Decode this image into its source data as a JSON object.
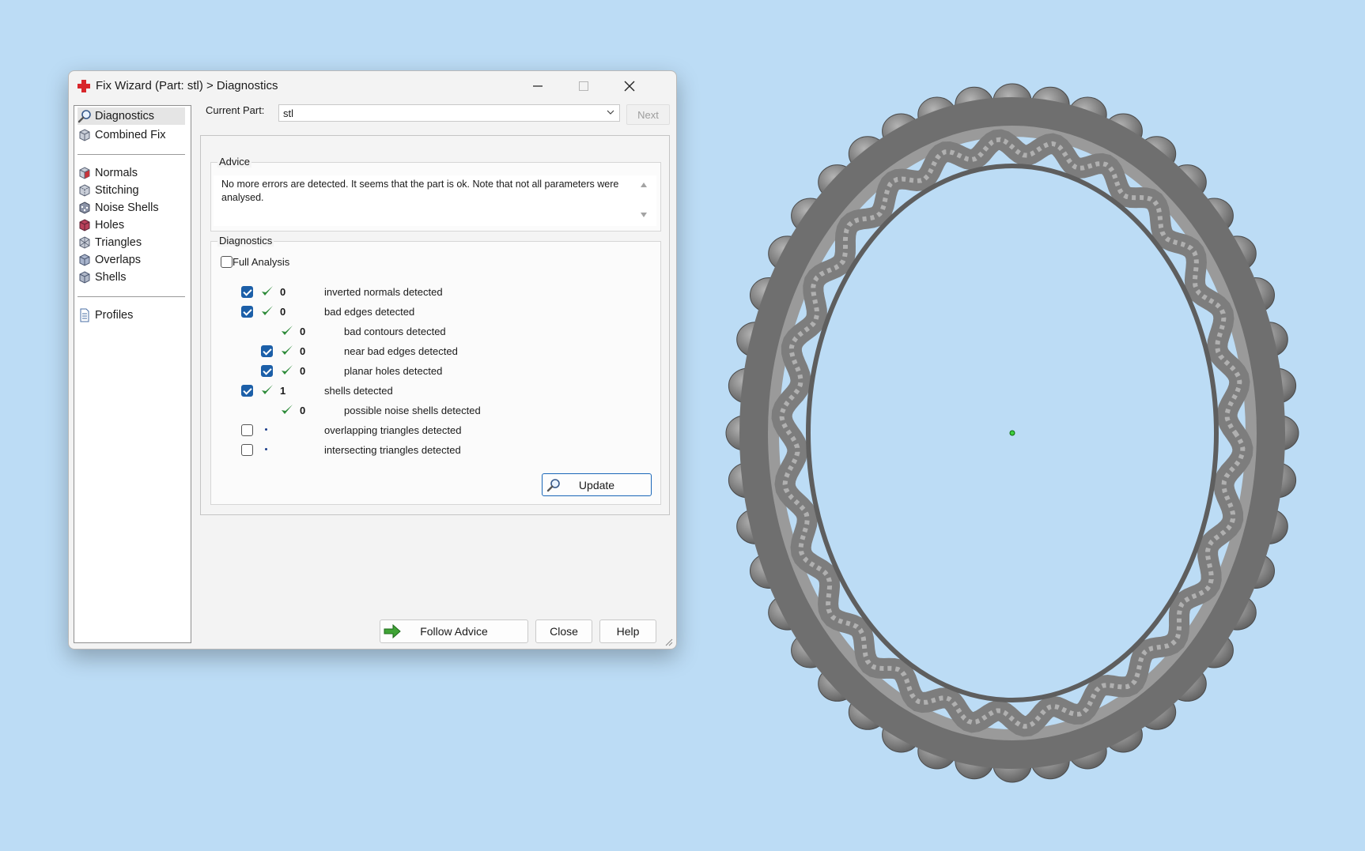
{
  "window": {
    "title": "Fix Wizard (Part: stl) > Diagnostics"
  },
  "nav": {
    "items": [
      {
        "label": "Diagnostics",
        "icon": "magnifier-icon",
        "selected": true
      },
      {
        "label": "Combined Fix",
        "icon": "cube-icon"
      },
      {
        "label": "Normals",
        "icon": "cube-icon"
      },
      {
        "label": "Stitching",
        "icon": "cube-icon"
      },
      {
        "label": "Noise Shells",
        "icon": "cube-icon"
      },
      {
        "label": "Holes",
        "icon": "cube-icon"
      },
      {
        "label": "Triangles",
        "icon": "cube-icon"
      },
      {
        "label": "Overlaps",
        "icon": "cube-icon"
      },
      {
        "label": "Shells",
        "icon": "cube-icon"
      },
      {
        "label": "Profiles",
        "icon": "document-icon"
      }
    ]
  },
  "current_part": {
    "label": "Current Part:",
    "value": "stl"
  },
  "next_label": "Next",
  "advice": {
    "title": "Advice",
    "text": "No more errors are detected. It seems that the part is ok. Note that not all parameters were analysed."
  },
  "diagnostics": {
    "title": "Diagnostics",
    "full_analysis_label": "Full Analysis",
    "rows": [
      {
        "checkbox": true,
        "checked": true,
        "status": "ok",
        "count": "0",
        "label": "inverted normals detected",
        "indent": 0
      },
      {
        "checkbox": true,
        "checked": true,
        "status": "ok",
        "count": "0",
        "label": "bad edges detected",
        "indent": 0
      },
      {
        "checkbox": false,
        "checked": false,
        "status": "ok",
        "count": "0",
        "label": "bad contours detected",
        "indent": 1
      },
      {
        "checkbox": true,
        "checked": true,
        "status": "ok",
        "count": "0",
        "label": "near bad edges detected",
        "indent": 1
      },
      {
        "checkbox": true,
        "checked": true,
        "status": "ok",
        "count": "0",
        "label": "planar holes detected",
        "indent": 1
      },
      {
        "checkbox": true,
        "checked": true,
        "status": "ok",
        "count": "1",
        "label": "shells detected",
        "indent": 0
      },
      {
        "checkbox": false,
        "checked": false,
        "status": "ok",
        "count": "0",
        "label": "possible noise shells detected",
        "indent": 1
      },
      {
        "checkbox": true,
        "checked": false,
        "status": "unknown",
        "count": "",
        "label": "overlapping triangles detected",
        "indent": 0
      },
      {
        "checkbox": true,
        "checked": false,
        "status": "unknown",
        "count": "",
        "label": "intersecting triangles detected",
        "indent": 0
      }
    ],
    "update_label": "Update"
  },
  "footer": {
    "follow_advice_label": "Follow Advice",
    "close_label": "Close",
    "help_label": "Help"
  },
  "colors": {
    "background": "#bcdcf5",
    "accent": "#1c5fa8",
    "ok_tick": "#2e8b3a",
    "model": "#8a8a8a"
  }
}
